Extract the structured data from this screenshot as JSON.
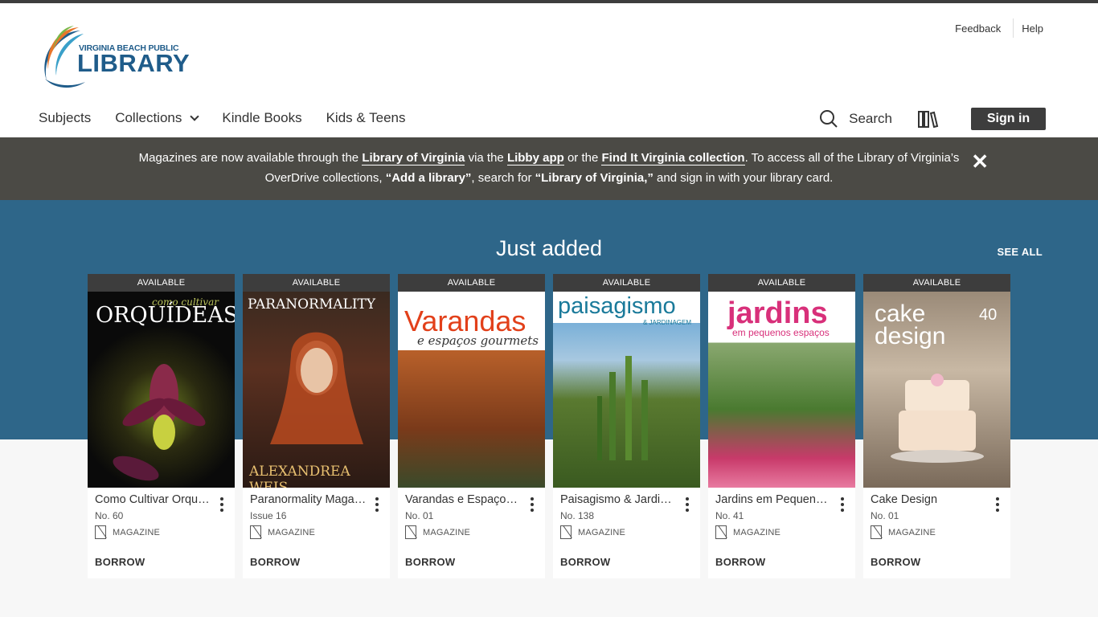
{
  "header": {
    "logo_small": "VIRGINIA BEACH PUBLIC",
    "logo_big": "LIBRARY",
    "feedback": "Feedback",
    "help": "Help"
  },
  "nav": {
    "subjects": "Subjects",
    "collections": "Collections",
    "kindle": "Kindle Books",
    "kids": "Kids & Teens",
    "search": "Search",
    "signin": "Sign in"
  },
  "banner": {
    "t1": "Magazines are now available through the ",
    "l1": "Library of Virginia",
    "t2": " via the ",
    "l2": "Libby app",
    "t3": " or the ",
    "l3": "Find It Virginia collection",
    "t4": ". To access all of the Library of Virginia’s",
    "t5": "OverDrive collections, ",
    "q1": "“Add a library”",
    "t6": ", search for ",
    "q2": "“Library of Virginia,”",
    "t7": " and sign in with your library card."
  },
  "section": {
    "title": "Just added",
    "see_all": "SEE ALL"
  },
  "cards": [
    {
      "status": "AVAILABLE",
      "title": "Como Cultivar Orquídeas",
      "issue": "No. 60",
      "format": "MAGAZINE",
      "action": "BORROW",
      "cover_title": "ORQUÍDEAS",
      "cover_sub": "como cultivar"
    },
    {
      "status": "AVAILABLE",
      "title": "Paranormality Magazine",
      "issue": "Issue 16",
      "format": "MAGAZINE",
      "action": "BORROW",
      "cover_title": "PARANORMALITY",
      "cover_sub": "ALEXANDREA WEIS"
    },
    {
      "status": "AVAILABLE",
      "title": "Varandas e Espaços Gourmets",
      "issue": "No. 01",
      "format": "MAGAZINE",
      "action": "BORROW",
      "cover_title": "Varandas",
      "cover_sub": "e espaços gourmets"
    },
    {
      "status": "AVAILABLE",
      "title": "Paisagismo & Jardinagem",
      "issue": "No. 138",
      "format": "MAGAZINE",
      "action": "BORROW",
      "cover_title": "paisagismo",
      "cover_sub": "& JARDINAGEM"
    },
    {
      "status": "AVAILABLE",
      "title": "Jardins em Pequenos Espaços",
      "issue": "No. 41",
      "format": "MAGAZINE",
      "action": "BORROW",
      "cover_title": "jardins",
      "cover_sub": "em pequenos espaços"
    },
    {
      "status": "AVAILABLE",
      "title": "Cake Design",
      "issue": "No. 01",
      "format": "MAGAZINE",
      "action": "BORROW",
      "cover_title": "cake design",
      "cover_sub": "40"
    }
  ],
  "colors": {
    "hero": "#2e6689",
    "banner": "#4b4a45",
    "dark": "#3d3d3d"
  },
  "icons": [
    "search-icon",
    "shelf-icon",
    "close-icon",
    "chevron-down-icon",
    "magazine-icon",
    "kebab-icon"
  ]
}
